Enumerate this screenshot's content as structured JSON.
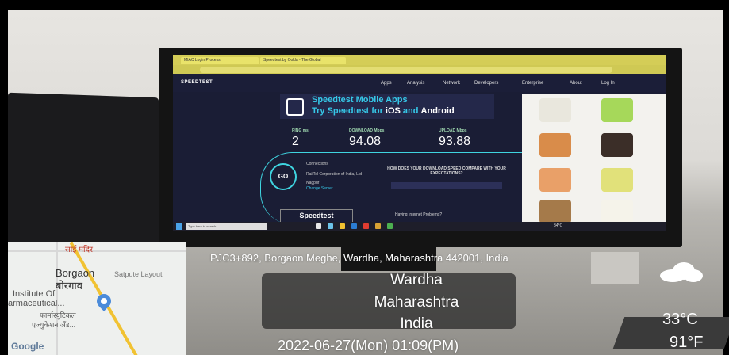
{
  "browser": {
    "tabs": [
      "MIAC Login Process",
      "Speedtest by Ookla - The Global"
    ],
    "address": "speedtest.net/result/…"
  },
  "speedtest": {
    "logo": "SPEEDTEST",
    "nav": [
      "Apps",
      "Analysis",
      "Network",
      "Developers",
      "Enterprise",
      "About",
      "Log In"
    ],
    "banner_title": "Speedtest Mobile Apps",
    "banner_sub_prefix": "Try Speedtest for ",
    "banner_sub_ios": "iOS",
    "banner_sub_and": " and ",
    "banner_sub_android": "Android",
    "ping_label": "PING ms",
    "ping_value": "2",
    "download_label": "DOWNLOAD Mbps",
    "download_value": "94.08",
    "upload_label": "UPLOAD Mbps",
    "upload_value": "93.88",
    "go": "GO",
    "connections": "Connections",
    "isp": "RailTel Corporation of India, Ltd",
    "server": "Nagpur",
    "change_server": "Change Server",
    "question": "HOW DOES YOUR DOWNLOAD SPEED COMPARE WITH YOUR EXPECTATIONS?",
    "speedtest_box": "Speedtest",
    "problem": "Having Internet Problems?"
  },
  "taskbar": {
    "search_placeholder": "Type here to search",
    "weather": "34°C"
  },
  "map": {
    "label_top": "साई मंदिर",
    "place_en": "Borgaon",
    "place_hi": "बोरगाव",
    "layout": "Satpute Layout",
    "institute": "Institute Of",
    "pharma": "armaceutical...",
    "pharma_hi": "फार्मास्युटिकल",
    "edu_hi": "एज्युकेशन अँड...",
    "google": "Google"
  },
  "overlay": {
    "address": "PJC3+892, Borgaon Meghe, Wardha, Maharashtra 442001, India",
    "city": "Wardha",
    "state": "Maharashtra",
    "country": "India",
    "datetime": "2022-06-27(Mon)  01:09(PM)",
    "temp_c": "33°C",
    "temp_f": "91°F"
  }
}
